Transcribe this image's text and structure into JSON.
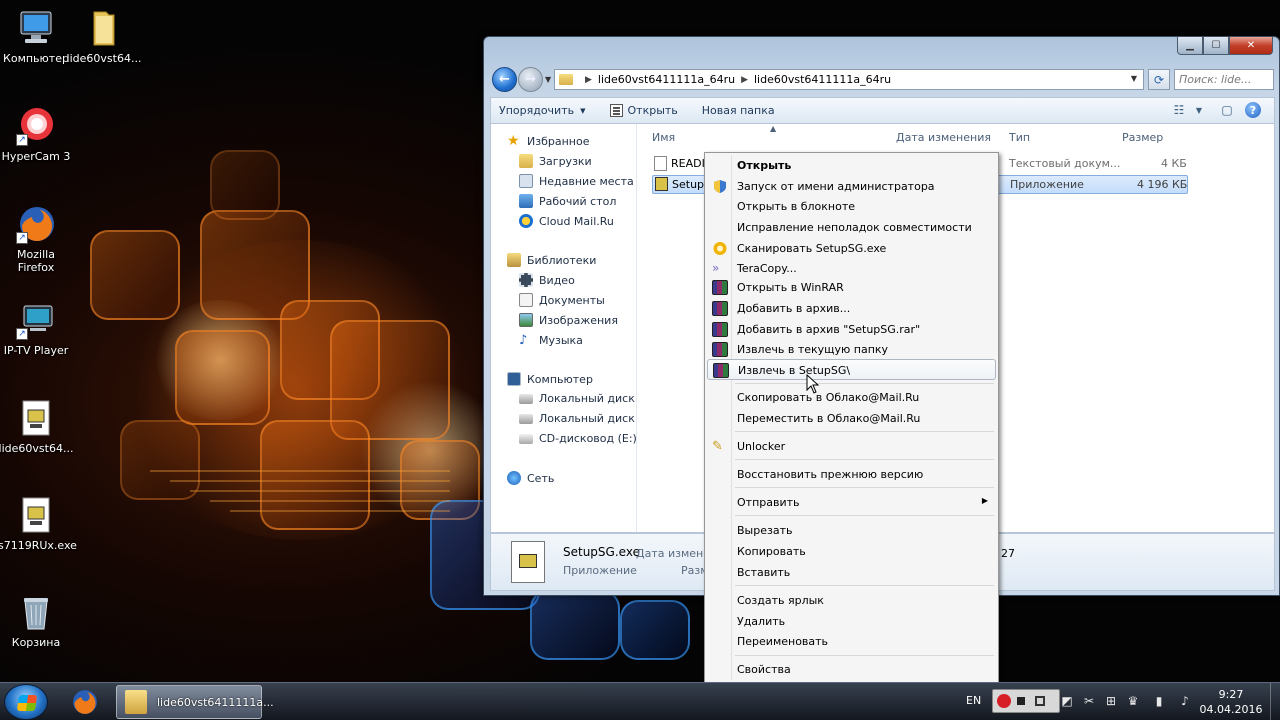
{
  "desktop": {
    "icons": [
      {
        "label": "Компьютер",
        "icon": "computer-icon"
      },
      {
        "label": "lide60vst64...",
        "icon": "folder-icon"
      },
      {
        "label": "HyperCam 3",
        "icon": "hypercam-icon"
      },
      {
        "label": "Mozilla Firefox",
        "icon": "firefox-icon"
      },
      {
        "label": "IP-TV Player",
        "icon": "iptv-player-icon"
      },
      {
        "label": "lide60vst64...",
        "icon": "installer-icon"
      },
      {
        "label": "s7119RUx.exe",
        "icon": "installer-icon"
      },
      {
        "label": "Корзина",
        "icon": "recycle-bin-icon"
      }
    ]
  },
  "explorer": {
    "address": {
      "segments": [
        "lide60vst6411111a_64ru",
        "lide60vst6411111a_64ru"
      ]
    },
    "search_placeholder": "Поиск: lide...",
    "toolbar": {
      "organize": "Упорядочить",
      "open": "Открыть",
      "new_folder": "Новая папка"
    },
    "nav_pane": {
      "favorites": "Избранное",
      "favorites_items": [
        "Загрузки",
        "Недавние места",
        "Рабочий стол",
        "Cloud Mail.Ru"
      ],
      "libraries": "Библиотеки",
      "libraries_items": [
        "Видео",
        "Документы",
        "Изображения",
        "Музыка"
      ],
      "computer": "Компьютер",
      "computer_items": [
        "Локальный диск (C",
        "Локальный диск (D",
        "CD-дисковод (E:)"
      ],
      "network": "Сеть"
    },
    "columns": {
      "name": "Имя",
      "date": "Дата изменения",
      "type": "Тип",
      "size": "Размер"
    },
    "files": [
      {
        "name": "READI",
        "type": "Текстовый докум...",
        "size": "4 КБ"
      },
      {
        "name": "Setup",
        "type": "Приложение",
        "size": "4 196 КБ"
      }
    ],
    "details": {
      "filename": "SetupSG.exe",
      "date_label": "Дата изменен",
      "type": "Приложение",
      "size_label": "Разм",
      "trailing": "27"
    }
  },
  "context_menu": {
    "items": [
      {
        "label": "Открыть",
        "bold": true
      },
      {
        "label": "Запуск от имени администратора",
        "icon": "shield-icon"
      },
      {
        "label": "Открыть в блокноте"
      },
      {
        "label": "Исправление неполадок совместимости"
      },
      {
        "label": "Сканировать SetupSG.exe",
        "icon": "antivirus-icon"
      },
      {
        "label": "TeraCopy...",
        "icon": "teracopy-icon"
      },
      {
        "label": "Открыть в WinRAR",
        "icon": "winrar-icon"
      },
      {
        "label": "Добавить в архив...",
        "icon": "winrar-icon"
      },
      {
        "label": "Добавить в архив \"SetupSG.rar\"",
        "icon": "winrar-icon"
      },
      {
        "label": "Извлечь в текущую папку",
        "icon": "winrar-icon"
      },
      {
        "label": "Извлечь в SetupSG\\",
        "icon": "winrar-icon",
        "hover": true
      },
      {
        "label": "Скопировать в Облако@Mail.Ru"
      },
      {
        "label": "Переместить в Облако@Mail.Ru"
      },
      {
        "label": "Unlocker",
        "icon": "unlocker-icon"
      },
      {
        "label": "Восстановить прежнюю версию"
      },
      {
        "label": "Отправить",
        "submenu": true
      },
      {
        "label": "Вырезать"
      },
      {
        "label": "Копировать"
      },
      {
        "label": "Вставить"
      },
      {
        "label": "Создать ярлык"
      },
      {
        "label": "Удалить"
      },
      {
        "label": "Переименовать"
      },
      {
        "label": "Свойства"
      }
    ]
  },
  "taskbar": {
    "explorer_task": "lide60vst6411111a...",
    "language": "EN",
    "time": "9:27",
    "date": "04.04.2016"
  },
  "colors": {
    "accent": "#1f6fd0",
    "selection": "#c4ddfc",
    "close_button": "#c2402a"
  }
}
